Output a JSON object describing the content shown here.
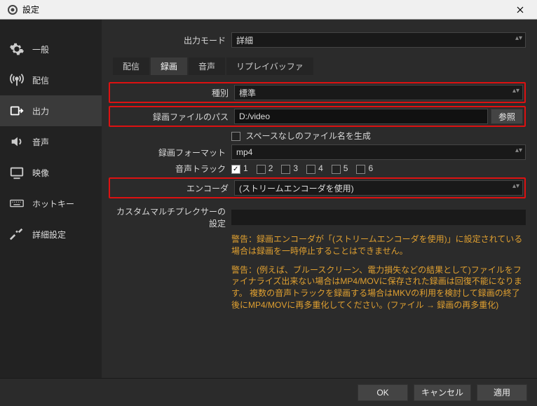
{
  "window": {
    "title": "設定"
  },
  "sidebar": {
    "items": [
      {
        "label": "一般"
      },
      {
        "label": "配信"
      },
      {
        "label": "出力"
      },
      {
        "label": "音声"
      },
      {
        "label": "映像"
      },
      {
        "label": "ホットキー"
      },
      {
        "label": "詳細設定"
      }
    ]
  },
  "output_mode": {
    "label": "出力モード",
    "value": "詳細"
  },
  "tabs": [
    {
      "label": "配信"
    },
    {
      "label": "録画"
    },
    {
      "label": "音声"
    },
    {
      "label": "リプレイバッファ"
    }
  ],
  "recording": {
    "type": {
      "label": "種別",
      "value": "標準"
    },
    "path": {
      "label": "録画ファイルのパス",
      "value": "D:/video",
      "browse": "参照"
    },
    "no_space": {
      "label": "スペースなしのファイル名を生成",
      "checked": false
    },
    "format": {
      "label": "録画フォーマット",
      "value": "mp4"
    },
    "tracks": {
      "label": "音声トラック",
      "items": [
        "1",
        "2",
        "3",
        "4",
        "5",
        "6"
      ],
      "checked": [
        true,
        false,
        false,
        false,
        false,
        false
      ]
    },
    "encoder": {
      "label": "エンコーダ",
      "value": "(ストリームエンコーダを使用)"
    },
    "muxer": {
      "label": "カスタムマルチプレクサーの設定"
    }
  },
  "warnings": {
    "w1": "警告：録画エンコーダが「(ストリームエンコーダを使用)」に設定されている場合は録画を一時停止することはできません。",
    "w2": "警告：(例えば、ブルースクリーン、電力損失などの結果として)ファイルをファイナライズ出来ない場合はMP4/MOVに保存された録画は回復不能になります。 複数の音声トラックを録画する場合はMKVの利用を検討して録画の終了後にMP4/MOVに再多重化してください。(ファイル → 録画の再多重化)"
  },
  "footer": {
    "ok": "OK",
    "cancel": "キャンセル",
    "apply": "適用"
  }
}
